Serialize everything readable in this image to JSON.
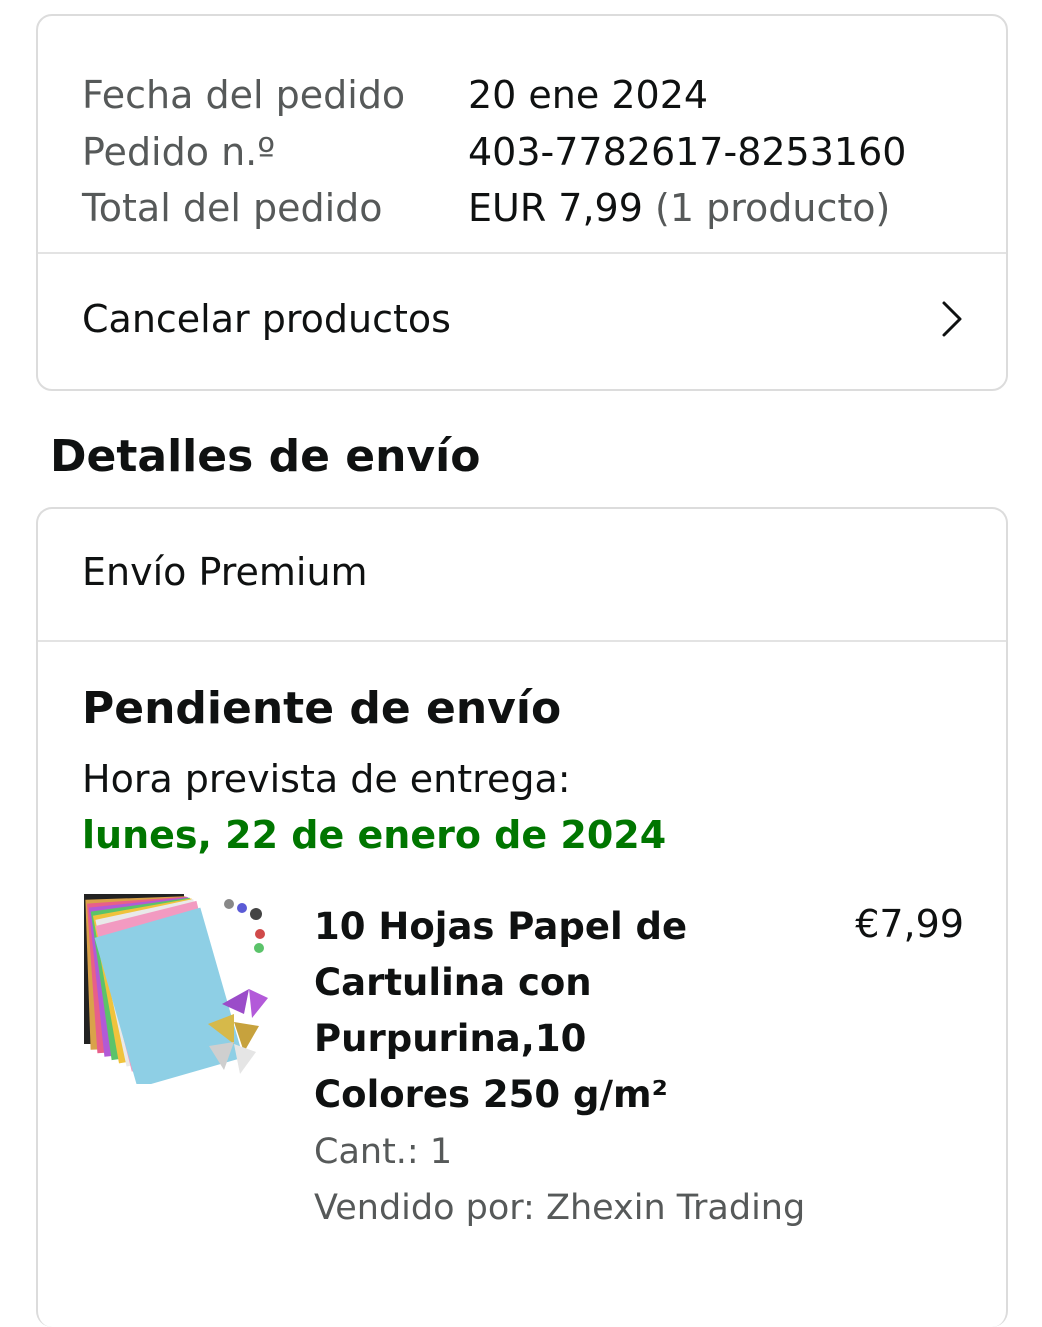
{
  "order": {
    "fields": [
      {
        "label": "Fecha del pedido",
        "value": "20 ene 2024"
      },
      {
        "label": "Pedido n.º",
        "value": "403-7782617-8253160"
      },
      {
        "label": "Total del pedido",
        "value": "EUR 7,99",
        "value_suffix": "(1 producto)"
      }
    ],
    "cancel_label": "Cancelar productos"
  },
  "shipping": {
    "section_title": "Detalles de envío",
    "method": "Envío Premium",
    "status": "Pendiente de envío",
    "eta_label": "Hora prevista de entrega:",
    "eta_date": "lunes, 22 de enero de 2024",
    "product": {
      "title": "10 Hojas Papel de Cartulina con Purpurina,10 Colores 250 g/m²",
      "price": "€7,99",
      "quantity": "Cant.: 1",
      "seller": "Vendido por: Zhexin Trading"
    }
  },
  "colors": {
    "eta_green": "#007600",
    "muted_text": "#565959",
    "primary_text": "#0f1111",
    "border": "#dcdcdc"
  },
  "icons": {
    "cancel_chevron": "chevron-right-icon"
  }
}
